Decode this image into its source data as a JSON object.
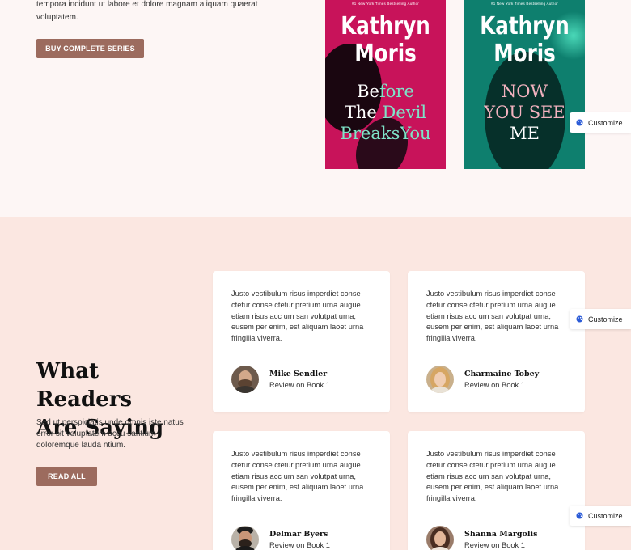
{
  "top": {
    "description": "tempora incidunt ut labore et dolore magnam aliquam quaerat voluptatem.",
    "buy_button": "BUY COMPLETE SERIES"
  },
  "books": [
    {
      "tagline": "#1 New York Times Bestselling Author",
      "author_line1": "Kathryn",
      "author_line2": "Moris",
      "title_part1": "Be",
      "title_part1_accent": "fore",
      "title_line2_plain": "The ",
      "title_line2_accent": "Devil",
      "title_line3_accent": "BreaksYou",
      "cover_color": "#c8135a"
    },
    {
      "tagline": "#1 New York Times Bestselling Author",
      "author_line1": "Kathryn",
      "author_line2": "Moris",
      "title_line1": "NOW",
      "title_line2": "YOU SEE",
      "title_line3": "ME",
      "cover_color": "#0e7f6e"
    }
  ],
  "customize_label": "Customize",
  "reviews": {
    "title_line1": "What Readers",
    "title_line2": "Are Saying",
    "description": "Sed ut perspiciatis unde omnis iste natus error sit voluptatem accu santium doloremque lauda ntium.",
    "read_all_button": "READ ALL",
    "items": [
      {
        "quote": "Justo vestibulum risus imperdiet conse ctetur conse ctetur pretium urna augue etiam risus acc um san volutpat urna, eusem per enim, est aliquam laoet urna fringilla viverra.",
        "name": "Mike Sendler",
        "subtitle": "Review on Book 1"
      },
      {
        "quote": "Justo vestibulum risus imperdiet conse ctetur conse ctetur pretium urna augue etiam risus acc um san volutpat urna, eusem per enim, est aliquam laoet urna fringilla viverra.",
        "name": "Charmaine Tobey",
        "subtitle": "Review on Book 1"
      },
      {
        "quote": "Justo vestibulum risus imperdiet conse ctetur conse ctetur pretium urna augue etiam risus acc um san volutpat urna, eusem per enim, est aliquam laoet urna fringilla viverra.",
        "name": "Delmar Byers",
        "subtitle": "Review on Book 1"
      },
      {
        "quote": "Justo vestibulum risus imperdiet conse ctetur conse ctetur pretium urna augue etiam risus acc um san volutpat urna, eusem per enim, est aliquam laoet urna fringilla viverra.",
        "name": "Shanna Margolis",
        "subtitle": "Review on Book 1"
      }
    ]
  },
  "colors": {
    "accent_button": "#9c6b5e",
    "top_background": "#fdf6f5",
    "reviews_background": "#fbe7e1"
  }
}
